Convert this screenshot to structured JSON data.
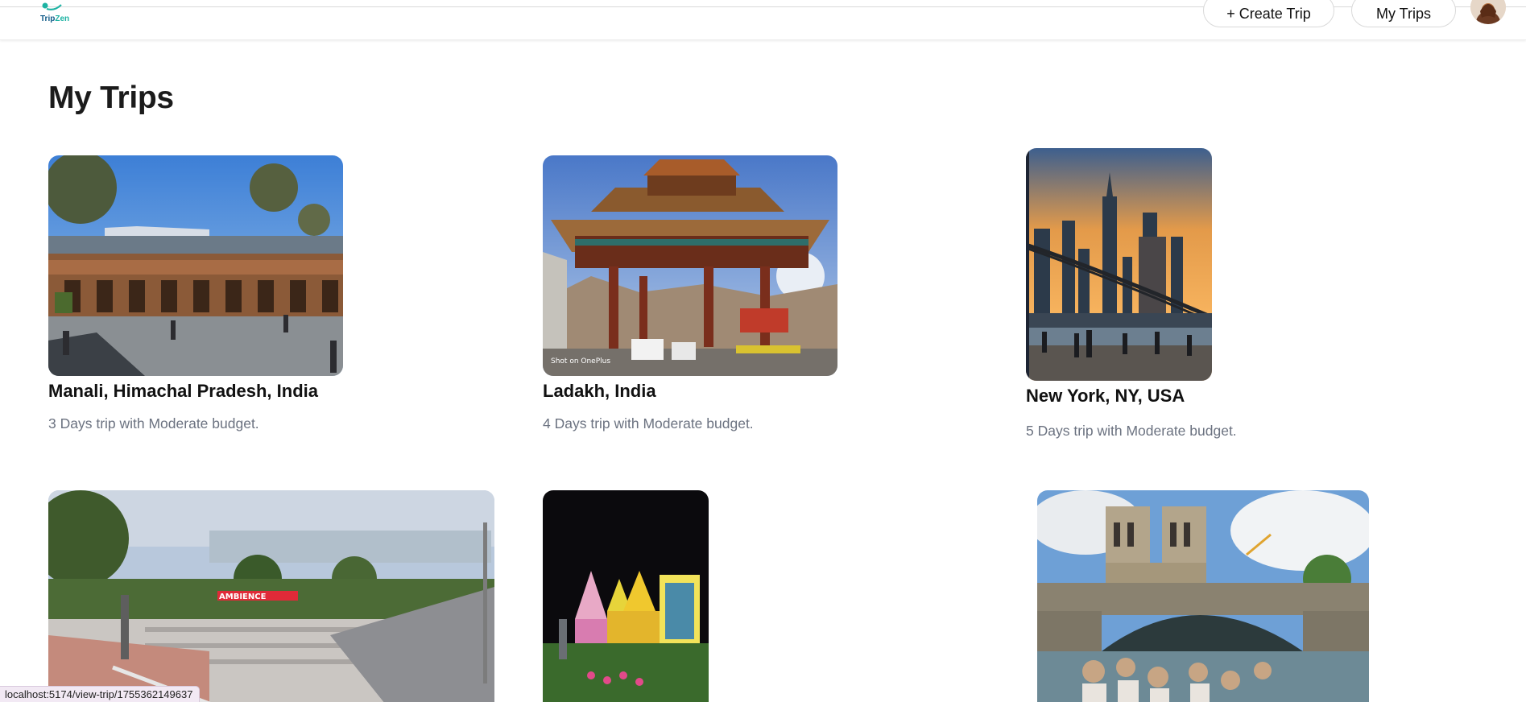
{
  "header": {
    "logo_text_a": "Trip",
    "logo_text_b": "Zen",
    "create_trip_label": "+ Create Trip",
    "my_trips_label": "My Trips",
    "avatar_icon": "user-avatar-icon"
  },
  "main": {
    "title": "My Trips",
    "trips": [
      {
        "name": "Manali, Himachal Pradesh, India",
        "description": "3 Days trip with Moderate budget."
      },
      {
        "name": "Ladakh, India",
        "description": "4 Days trip with Moderate budget.",
        "photo_watermark": "Shot on OnePlus"
      },
      {
        "name": "New York, NY, USA",
        "description": "5 Days trip with Moderate budget."
      },
      {
        "name": "",
        "description": "",
        "photo_sign": "AMBIENCE"
      },
      {
        "name": "",
        "description": ""
      },
      {
        "name": "",
        "description": ""
      }
    ]
  },
  "status_bar": {
    "url": "localhost:5174/view-trip/1755362149637"
  },
  "colors": {
    "accent_teal": "#1db3a3",
    "brand_blue": "#0f5b88",
    "muted_text": "#6b7280"
  }
}
